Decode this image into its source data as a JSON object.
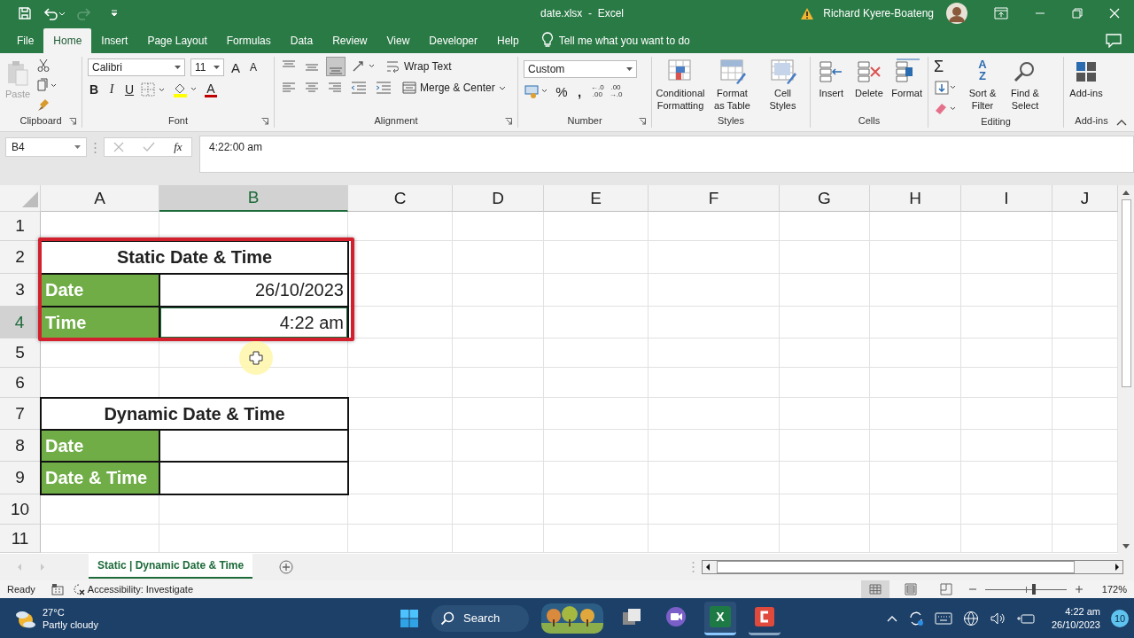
{
  "title_bar": {
    "file_name": "date.xlsx  -  Excel",
    "user": "Richard Kyere-Boateng",
    "redo_disabled": true
  },
  "menu_tabs": [
    {
      "label": "File",
      "selected": false
    },
    {
      "label": "Home",
      "selected": true
    },
    {
      "label": "Insert",
      "selected": false
    },
    {
      "label": "Page Layout",
      "selected": false
    },
    {
      "label": "Formulas",
      "selected": false
    },
    {
      "label": "Data",
      "selected": false
    },
    {
      "label": "Review",
      "selected": false
    },
    {
      "label": "View",
      "selected": false
    },
    {
      "label": "Developer",
      "selected": false
    },
    {
      "label": "Help",
      "selected": false
    }
  ],
  "tell_me": "Tell me what you want to do",
  "ribbon": {
    "clipboard": {
      "label": "Clipboard",
      "paste": "Paste",
      "paste_disabled": true
    },
    "font": {
      "label": "Font",
      "name": "Calibri",
      "size": "11",
      "grow": "A",
      "shrink": "A",
      "bold": "B",
      "italic": "I",
      "underline": "U",
      "font_color": "A"
    },
    "alignment": {
      "label": "Alignment",
      "wrap": "Wrap Text",
      "merge": "Merge & Center"
    },
    "number": {
      "label": "Number",
      "format": "Custom",
      "percent": "%",
      "comma": ",",
      "increase_decimal": [
        "←.0",
        ".00"
      ],
      "decrease_decimal": [
        ".00",
        "→.0"
      ]
    },
    "styles": {
      "label": "Styles",
      "buttons": [
        "Conditional Formatting",
        "Format as Table",
        "Cell Styles"
      ]
    },
    "cells": {
      "label": "Cells",
      "buttons": [
        "Insert",
        "Delete",
        "Format"
      ]
    },
    "editing": {
      "label": "Editing",
      "autosum": "Σ",
      "sort_letters": [
        "A",
        "Z"
      ],
      "buttons": [
        "Sort & Filter",
        "Find & Select"
      ]
    },
    "addins": {
      "label": "Add-ins",
      "buttons": [
        "Add-ins"
      ]
    }
  },
  "formula_bar": {
    "name_box": "B4",
    "fx": "fx",
    "content": "4:22:00 am"
  },
  "sheet": {
    "columns": [
      {
        "label": "A",
        "selected": false
      },
      {
        "label": "B",
        "selected": true
      },
      {
        "label": "C",
        "selected": false
      },
      {
        "label": "D",
        "selected": false
      },
      {
        "label": "E",
        "selected": false
      },
      {
        "label": "F",
        "selected": false
      },
      {
        "label": "G",
        "selected": false
      },
      {
        "label": "H",
        "selected": false
      },
      {
        "label": "I",
        "selected": false
      },
      {
        "label": "J",
        "selected": false
      }
    ],
    "rows": [
      {
        "label": "1",
        "selected": false
      },
      {
        "label": "2",
        "selected": false,
        "cells": [
          {
            "kind": "title",
            "text": "Static Date & Time"
          }
        ]
      },
      {
        "label": "3",
        "selected": false,
        "cells": [
          {
            "kind": "label",
            "text": "Date"
          },
          {
            "kind": "value",
            "text": "26/10/2023"
          }
        ]
      },
      {
        "label": "4",
        "selected": true,
        "cells": [
          {
            "kind": "label",
            "text": "Time"
          },
          {
            "kind": "value",
            "text": "4:22 am"
          }
        ]
      },
      {
        "label": "5",
        "selected": false
      },
      {
        "label": "6",
        "selected": false
      },
      {
        "label": "7",
        "selected": false,
        "cells": [
          {
            "kind": "title",
            "text": "Dynamic Date & Time"
          }
        ]
      },
      {
        "label": "8",
        "selected": false,
        "cells": [
          {
            "kind": "label",
            "text": "Date"
          },
          {
            "kind": "value"
          }
        ]
      },
      {
        "label": "9",
        "selected": false,
        "cells": [
          {
            "kind": "label",
            "text": "Date & Time"
          },
          {
            "kind": "value"
          }
        ]
      },
      {
        "label": "10",
        "selected": false
      },
      {
        "label": "11",
        "selected": false
      }
    ]
  },
  "sheet_tabs": [
    {
      "label": "Static | Dynamic Date & Time",
      "selected": true
    }
  ],
  "status_bar": {
    "ready": "Ready",
    "accessibility": "Accessibility: Investigate",
    "views": [
      {
        "selected": true
      },
      {
        "selected": false
      },
      {
        "selected": false
      }
    ],
    "zoom": {
      "level": 0.6
    },
    "zoom_text": "172%"
  },
  "taskbar": {
    "temperature": "27°C",
    "condition": "Partly cloudy",
    "search": "Search",
    "apps": [
      {
        "kind": "picture"
      },
      {
        "kind": "task-view",
        "active": false,
        "running": false
      },
      {
        "kind": "meet",
        "active": false,
        "running": false
      },
      {
        "kind": "excel",
        "glyph": "X",
        "active": true,
        "running": true
      },
      {
        "kind": "recorder",
        "active": false,
        "running": true
      }
    ],
    "time": "4:22 am",
    "date": "26/10/2023",
    "notifications": "10"
  }
}
